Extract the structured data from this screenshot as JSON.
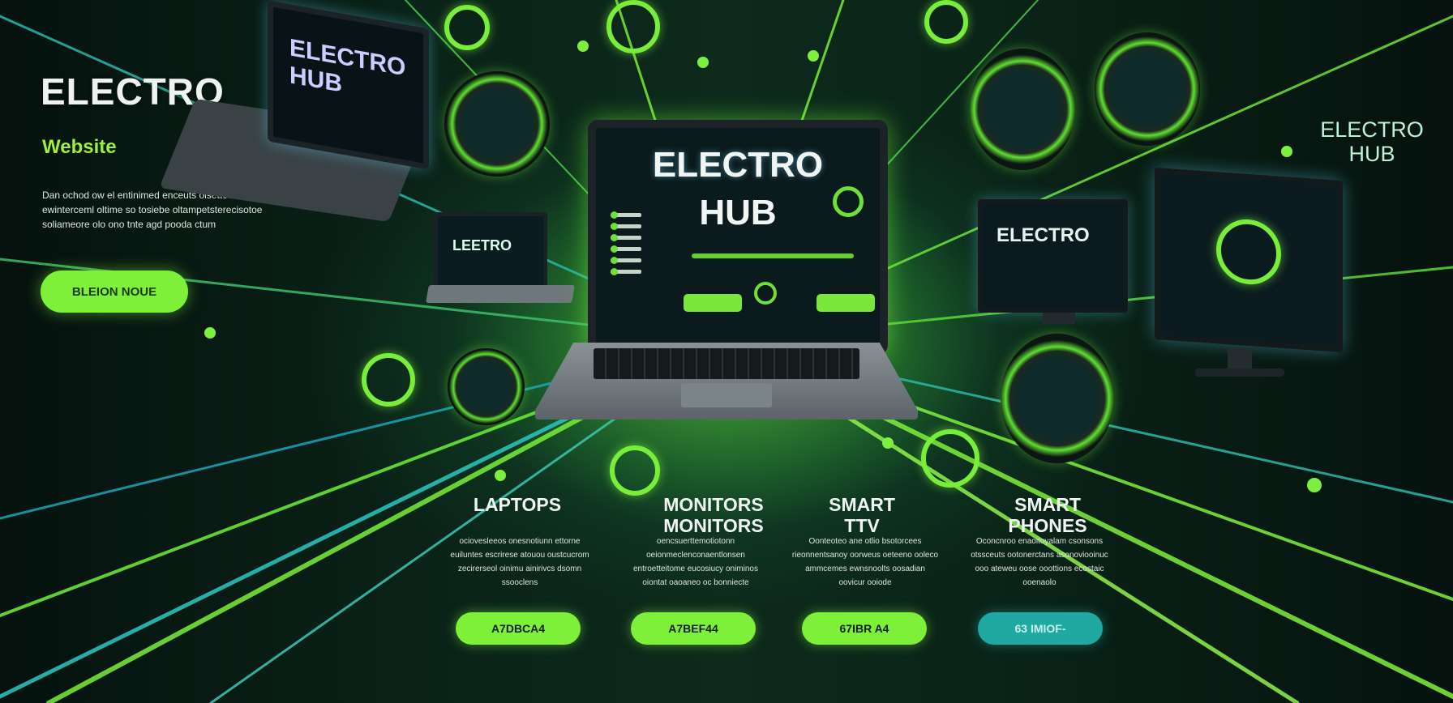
{
  "brand": {
    "title": "ELECTRO",
    "subtitle": "Website",
    "description": "Dan ochod ow el entinimed enceuts oisettoe ewinterceml oltime so tosiebe oltampetsterecisotoe soliameore olo ono tnte agd pooda ctum",
    "cta_label": "BLEION NOUE"
  },
  "brand_right": {
    "line1": "ELECTRO",
    "line2": "HUB"
  },
  "main_laptop": {
    "screen_title": "ELECTRO",
    "screen_subtitle": "HUB"
  },
  "side_devices": {
    "top_laptop_label": "ELECTRO HUB",
    "mid_laptop_label": "LEETRO",
    "monitor_label": "ELECTRO"
  },
  "categories": [
    {
      "title": "LAPTOPS",
      "desc": "ociovesleeos onesnotiunn ettorne euiluntes escrirese atouou oustcucrom zecirerseol oinimu ainirivcs dsomn ssooclens",
      "button": "A7DBCA4"
    },
    {
      "title": "MONITORS",
      "title_line2": "MONITORS",
      "desc": "oencsuerttemotiotonn oeionmeclenconaentlonsen entroetteitome eucosiucy oniminos oiontat oaoaneo oc bonniecte",
      "button": "A7BEF44"
    },
    {
      "title": "SMART",
      "title_line2": "TTV",
      "desc": "Oonteoteo ane otlio bsotorcees rieonnentsanoy oorweus oeteeno ooleco ammcemes ewnsnoolts oosadian oovicur ooiode",
      "button": "67IBR A4"
    },
    {
      "title": "SMART",
      "title_line2": "PHONES",
      "desc": "Oconcnroo enaoitoyalam csonsons otssceuts ootonerctans asonoviooinuc ooo ateweu oose ooottions ecostaic ooenaolo",
      "button": "63 IMIOF-"
    }
  ],
  "colors": {
    "accent_green": "#7ef03a",
    "accent_teal": "#1fa9a2",
    "background_dark": "#0a2318"
  }
}
